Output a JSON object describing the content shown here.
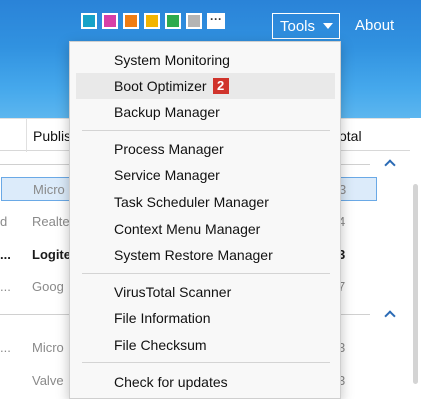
{
  "toolbar": {
    "swatches": [
      "#17a2c8",
      "#d63fa8",
      "#ef7d13",
      "#f2b400",
      "#2eaa4e",
      "#b4b4b4"
    ],
    "tools_label": "Tools",
    "about_label": "About"
  },
  "table": {
    "headers": {
      "publisher": "Publis",
      "total": "otal"
    },
    "rows": [
      {
        "left": "",
        "publisher": "Micro",
        "total": "3"
      },
      {
        "left": "d",
        "publisher": "Realte",
        "total": "4"
      },
      {
        "left": "...",
        "publisher": "Logite",
        "total": "3"
      },
      {
        "left": "...",
        "publisher": "Goog",
        "total": "7"
      },
      {
        "left": "...",
        "publisher": "Micro",
        "total": "3"
      },
      {
        "left": "",
        "publisher": "Valve",
        "total": "3"
      }
    ]
  },
  "menu": {
    "system_monitoring": "System Monitoring",
    "boot_optimizer": "Boot Optimizer",
    "boot_optimizer_badge": "2",
    "backup_manager": "Backup Manager",
    "process_manager": "Process Manager",
    "service_manager": "Service Manager",
    "task_scheduler_manager": "Task Scheduler Manager",
    "context_menu_manager": "Context Menu Manager",
    "system_restore_manager": "System Restore Manager",
    "virustotal_scanner": "VirusTotal Scanner",
    "file_information": "File Information",
    "file_checksum": "File Checksum",
    "check_for_updates": "Check for updates"
  }
}
